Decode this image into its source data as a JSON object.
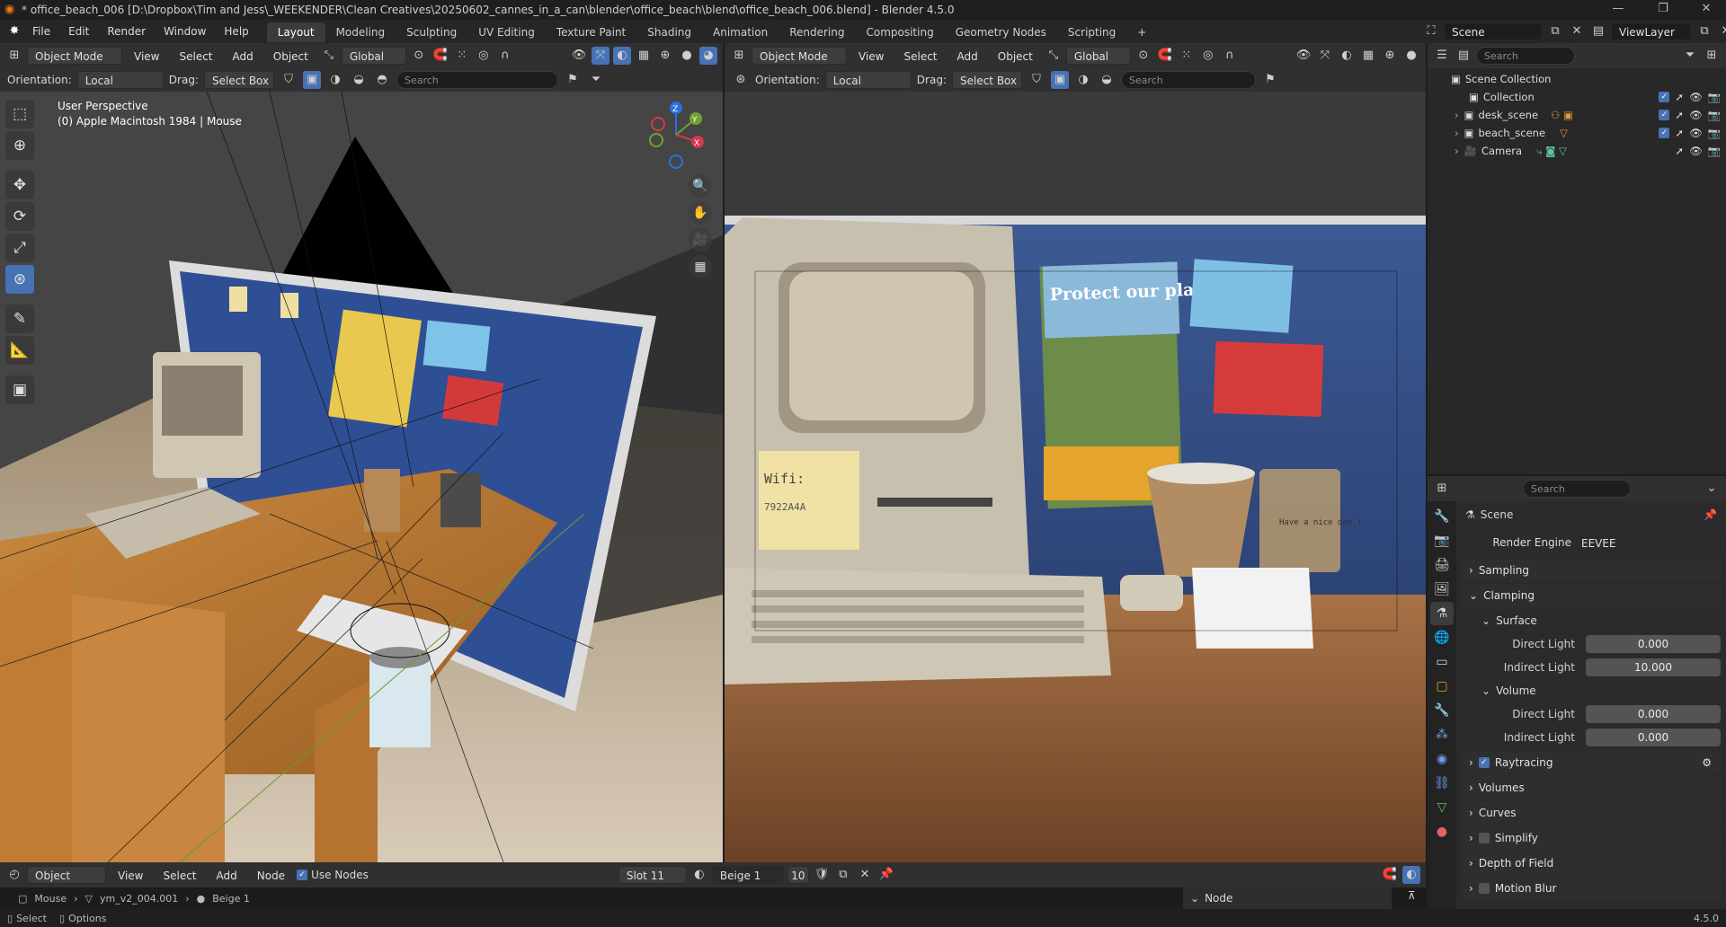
{
  "titlebar": {
    "title": "* office_beach_006 [D:\\Dropbox\\Tim and Jess\\_WEEKENDER\\Clean Creatives\\20250602_cannes_in_a_can\\blender\\office_beach\\blend\\office_beach_006.blend] - Blender 4.5.0",
    "minimize": "—",
    "restore": "❐",
    "close": "✕"
  },
  "menu": {
    "items": [
      "File",
      "Edit",
      "Render",
      "Window",
      "Help"
    ],
    "workspaces": [
      "Layout",
      "Modeling",
      "Sculpting",
      "UV Editing",
      "Texture Paint",
      "Shading",
      "Animation",
      "Rendering",
      "Compositing",
      "Geometry Nodes",
      "Scripting"
    ],
    "add_tab": "+",
    "scene": "Scene",
    "view_layer": "ViewLayer"
  },
  "viewport_left": {
    "mode": "Object Mode",
    "menus": [
      "View",
      "Select",
      "Add",
      "Object"
    ],
    "transform": "Global",
    "orientation_label": "Orientation:",
    "orientation_value": "Local",
    "drag_label": "Drag:",
    "drag_value": "Select Box",
    "search_placeholder": "Search",
    "overlay_title": "User Perspective",
    "overlay_sub": "(0) Apple Macintosh 1984 | Mouse",
    "gizmo": {
      "z": "Z",
      "y": "Y",
      "x": "X"
    }
  },
  "viewport_right": {
    "mode": "Object Mode",
    "menus": [
      "View",
      "Select",
      "Add",
      "Object"
    ],
    "transform": "Global",
    "orientation_label": "Orientation:",
    "orientation_value": "Local",
    "drag_label": "Drag:",
    "drag_value": "Select Box",
    "search_placeholder": "Search",
    "sticky_text_1": "Wifi:",
    "sticky_text_2": "7922A4A",
    "poster_text": "Protect our planet",
    "pot_label": "Have a nice day !"
  },
  "outliner": {
    "search_placeholder": "Search",
    "root": "Scene Collection",
    "items": [
      {
        "name": "Collection"
      },
      {
        "name": "desk_scene"
      },
      {
        "name": "beach_scene"
      },
      {
        "name": "Camera"
      }
    ]
  },
  "properties": {
    "search_placeholder": "Search",
    "context": "Scene",
    "render_engine_label": "Render Engine",
    "render_engine_value": "EEVEE",
    "panels": {
      "sampling": "Sampling",
      "clamping": "Clamping",
      "surface": "Surface",
      "volume": "Volume",
      "raytracing": "Raytracing",
      "volumes": "Volumes",
      "curves": "Curves",
      "simplify": "Simplify",
      "dof": "Depth of Field",
      "motion_blur": "Motion Blur"
    },
    "surface_direct_label": "Direct Light",
    "surface_direct": "0.000",
    "surface_indirect_label": "Indirect Light",
    "surface_indirect": "10.000",
    "volume_direct_label": "Direct Light",
    "volume_direct": "0.000",
    "volume_indirect_label": "Indirect Light",
    "volume_indirect": "0.000"
  },
  "node_editor": {
    "mode": "Object",
    "menus": [
      "View",
      "Select",
      "Add",
      "Node"
    ],
    "use_nodes": "Use Nodes",
    "slot": "Slot 11",
    "material": "Beige 1",
    "users": "10",
    "breadcrumb": [
      "Mouse",
      "ym_v2_004.001",
      "Beige 1"
    ],
    "sidebar_node": "Node"
  },
  "status": {
    "select": "Select",
    "options": "Options",
    "version": "4.5.0"
  }
}
